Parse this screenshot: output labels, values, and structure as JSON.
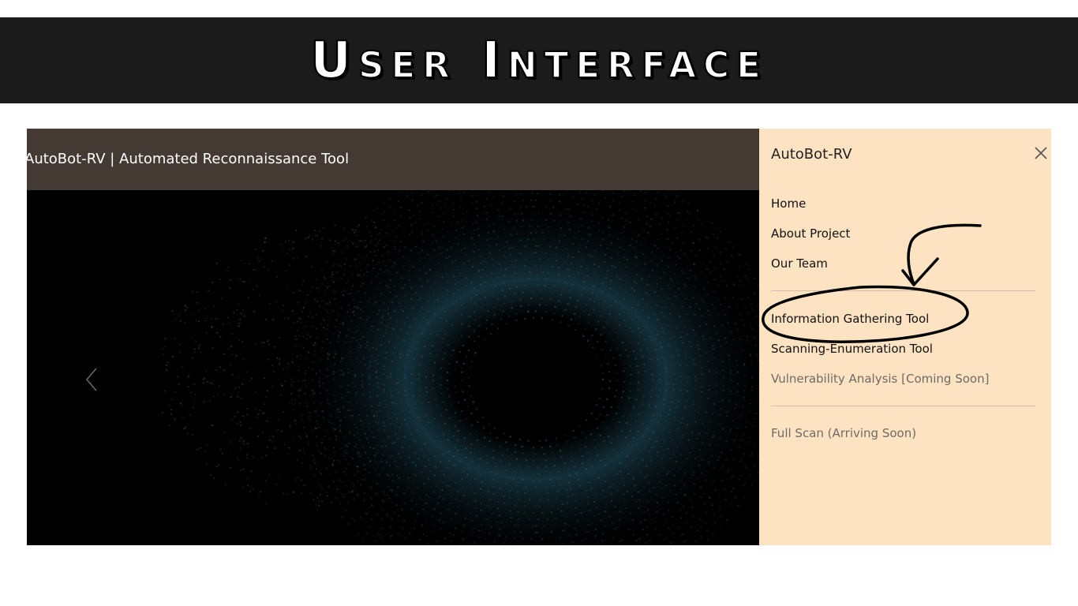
{
  "banner": {
    "title": "User Interface"
  },
  "app": {
    "title": "AutoBot-RV | Automated Reconnaissance Tool"
  },
  "carousel": {
    "prev_icon": "chevron-left-icon"
  },
  "sidebar": {
    "brand": "AutoBot-RV",
    "close_icon": "close-icon",
    "primary": [
      "Home",
      "About Project",
      "Our Team"
    ],
    "tools": [
      "Information Gathering Tool",
      "Scanning-Enumeration Tool",
      "Vulnerability Analysis [Coming Soon]"
    ],
    "extra": [
      "Full Scan (Arriving Soon)"
    ]
  },
  "colors": {
    "banner_bg": "#1b1b1b",
    "header_bg": "#453a33",
    "sidebar_bg": "#fde3c2",
    "hero_accent": "#2f5f6e",
    "muted_text": "#6f6a66"
  }
}
